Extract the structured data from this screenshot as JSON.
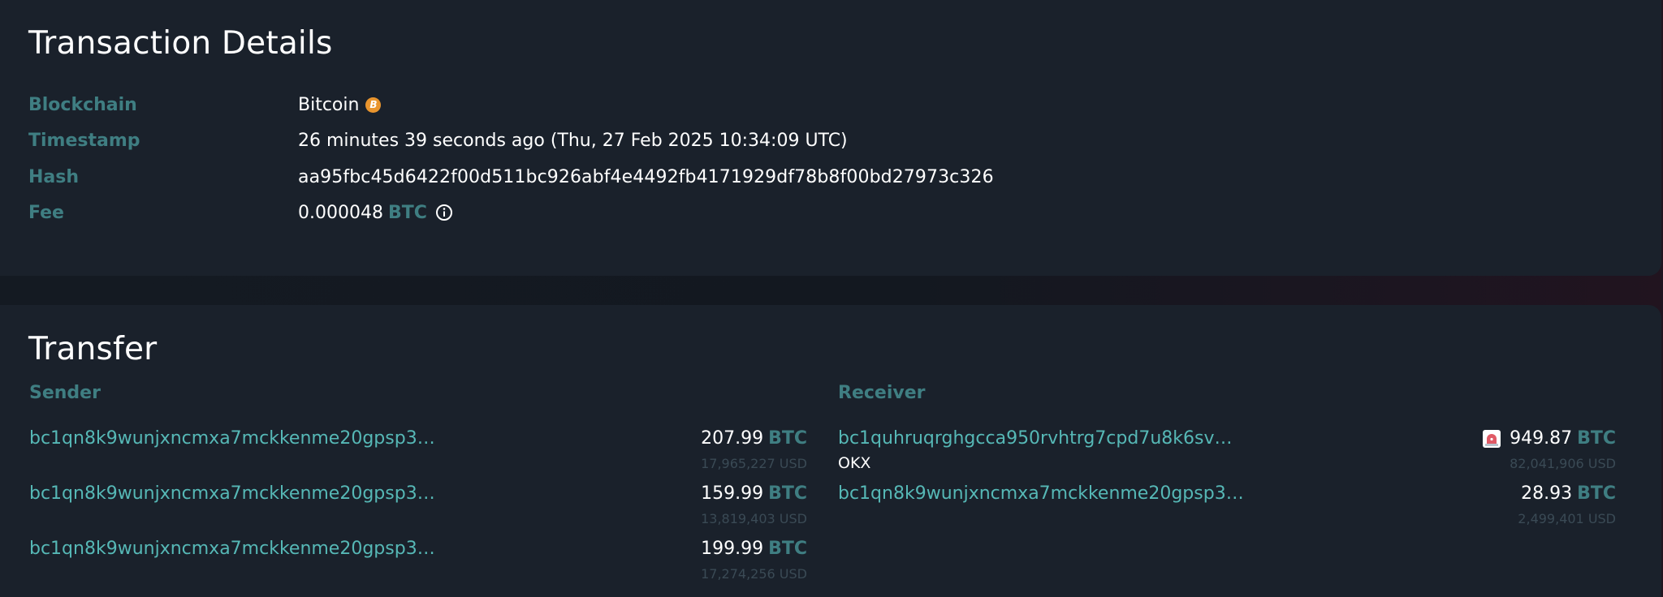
{
  "details": {
    "title": "Transaction Details",
    "rows": {
      "blockchain": {
        "label": "Blockchain",
        "value": "Bitcoin",
        "icon": "bitcoin-icon",
        "icon_glyph": "B"
      },
      "timestamp": {
        "label": "Timestamp",
        "value": "26 minutes 39 seconds ago (Thu, 27 Feb 2025 10:34:09 UTC)"
      },
      "hash": {
        "label": "Hash",
        "value": "aa95fbc45d6422f00d511bc926abf4e4492fb4171929df78b8f00bd27973c326"
      },
      "fee": {
        "label": "Fee",
        "value": "0.000048",
        "unit": "BTC",
        "icon": "info-icon"
      }
    }
  },
  "transfer": {
    "title": "Transfer",
    "sender": {
      "heading": "Sender",
      "entries": [
        {
          "address": "bc1qn8k9wunjxncmxa7mckkenme20gpsp3…",
          "amount": "207.99",
          "unit": "BTC",
          "usd": "17,965,227 USD"
        },
        {
          "address": "bc1qn8k9wunjxncmxa7mckkenme20gpsp3…",
          "amount": "159.99",
          "unit": "BTC",
          "usd": "13,819,403 USD"
        },
        {
          "address": "bc1qn8k9wunjxncmxa7mckkenme20gpsp3…",
          "amount": "199.99",
          "unit": "BTC",
          "usd": "17,274,256 USD"
        }
      ]
    },
    "receiver": {
      "heading": "Receiver",
      "entries": [
        {
          "address": "bc1quhruqrghgcca950rvhtrg7cpd7u8k6sv…",
          "tag": "OKX",
          "alert_icon": "siren-icon",
          "amount": "949.87",
          "unit": "BTC",
          "usd": "82,041,906 USD"
        },
        {
          "address": "bc1qn8k9wunjxncmxa7mckkenme20gpsp3…",
          "amount": "28.93",
          "unit": "BTC",
          "usd": "2,499,401 USD"
        }
      ]
    }
  },
  "colors": {
    "label": "#3f7e82",
    "link": "#56b8b6",
    "panel": "#1a212b",
    "bitcoin": "#e9952e",
    "alert": "#e05a66"
  }
}
